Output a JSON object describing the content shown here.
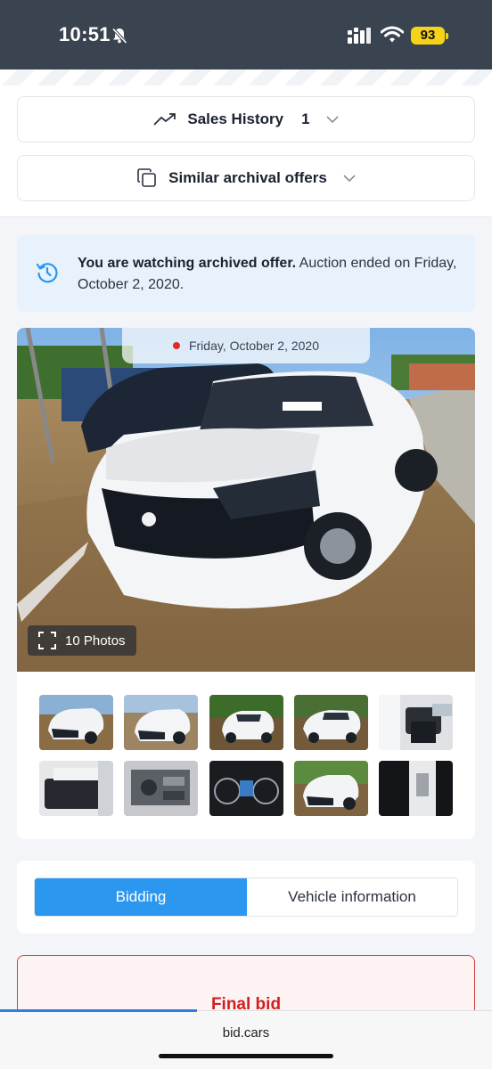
{
  "status_bar": {
    "time": "10:51",
    "battery": "93",
    "icons": [
      "bell-slash-icon",
      "signal-icon",
      "wifi-icon",
      "battery-icon"
    ]
  },
  "accordions": {
    "sales_history": {
      "label": "Sales History",
      "count": "1",
      "icon": "trend-up-icon"
    },
    "similar_offers": {
      "label": "Similar archival offers",
      "icon": "copy-icon"
    }
  },
  "notice": {
    "bold": "You are watching archived offer.",
    "text": " Auction ended on Friday, October 2, 2020.",
    "icon": "history-icon"
  },
  "gallery": {
    "date": "Friday, October 2, 2020",
    "photo_count": "10 Photos",
    "thumbnails": [
      "front-left",
      "front-left-alt",
      "rear-left",
      "rear-right",
      "interior-front",
      "interior-rear",
      "engine",
      "instrument-cluster",
      "front-right",
      "door-jamb"
    ]
  },
  "tabs": {
    "bidding": "Bidding",
    "vehicle_information": "Vehicle information",
    "active": "bidding"
  },
  "final_bid": {
    "label": "Final bid"
  },
  "browser": {
    "url": "bid.cars",
    "load_progress": 0.4
  },
  "colors": {
    "accent": "#2c97ef",
    "notice_bg": "#e7f2fd",
    "final_bid_red": "#d11f1f",
    "status_bar": "#3a4350",
    "battery": "#f5d417"
  }
}
